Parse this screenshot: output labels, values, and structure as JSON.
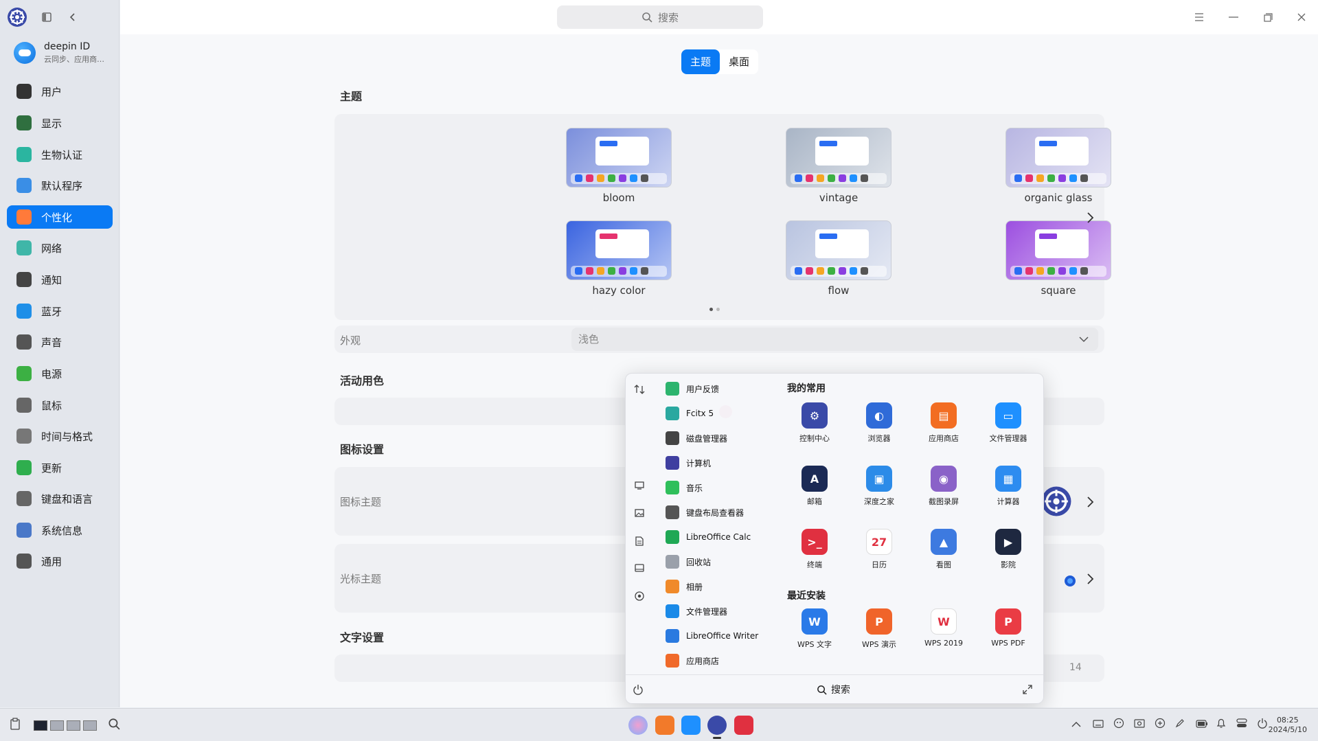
{
  "sidebar": {
    "deepin_id": {
      "name": "deepin ID",
      "subtitle": "云同步、应用商…"
    },
    "items": [
      {
        "label": "用户",
        "icon": "user-icon",
        "color": "#333333"
      },
      {
        "label": "显示",
        "icon": "display-icon",
        "color": "#2f6f3f"
      },
      {
        "label": "生物认证",
        "icon": "biometric-icon",
        "color": "#2bb5a0"
      },
      {
        "label": "默认程序",
        "icon": "default-apps-icon",
        "color": "#3a8ee6"
      },
      {
        "label": "个性化",
        "icon": "personalization-icon",
        "color": "#e35b2f"
      },
      {
        "label": "网络",
        "icon": "network-icon",
        "color": "#3fb6a8"
      },
      {
        "label": "通知",
        "icon": "notification-icon",
        "color": "#444444"
      },
      {
        "label": "蓝牙",
        "icon": "bluetooth-icon",
        "color": "#1f8fe8"
      },
      {
        "label": "声音",
        "icon": "sound-icon",
        "color": "#555555"
      },
      {
        "label": "电源",
        "icon": "power-icon",
        "color": "#3cb043"
      },
      {
        "label": "鼠标",
        "icon": "mouse-icon",
        "color": "#666666"
      },
      {
        "label": "时间与格式",
        "icon": "clock-icon",
        "color": "#777777"
      },
      {
        "label": "更新",
        "icon": "update-icon",
        "color": "#2fae4e"
      },
      {
        "label": "键盘和语言",
        "icon": "keyboard-icon",
        "color": "#666666"
      },
      {
        "label": "系统信息",
        "icon": "system-info-icon",
        "color": "#4a78c8"
      },
      {
        "label": "通用",
        "icon": "general-icon",
        "color": "#555555"
      }
    ],
    "active_index": 4
  },
  "search": {
    "placeholder": "搜索"
  },
  "tabs": [
    {
      "label": "主题",
      "active": true
    },
    {
      "label": "桌面",
      "active": false
    }
  ],
  "theme_section": {
    "title": "主题",
    "themes": [
      {
        "name": "bloom",
        "bg": "#7b8fdc",
        "bar": "#2a6df2"
      },
      {
        "name": "vintage",
        "bg": "#a9b5c6",
        "bar": "#2a6df2"
      },
      {
        "name": "organic glass",
        "bg": "#b8b6e2",
        "bar": "#2a6df2"
      },
      {
        "name": "hazy color",
        "bg": "#3a64e0",
        "bar": "#e5336e"
      },
      {
        "name": "flow",
        "bg": "#b9c4e0",
        "bar": "#2a6df2"
      },
      {
        "name": "square",
        "bg": "#9c4fe0",
        "bar": "#8a3ee0"
      }
    ],
    "appearance_label": "外观",
    "appearance_value": "浅色"
  },
  "accent_section": {
    "title": "活动用色",
    "color": "#e0336e"
  },
  "icon_section": {
    "title": "图标设置",
    "icon_theme_label": "图标主题",
    "cursor_theme_label": "光标主题"
  },
  "text_section": {
    "title": "文字设置",
    "size_value": "14"
  },
  "launcher": {
    "list": [
      {
        "label": "用户反馈",
        "color": "#2db46e"
      },
      {
        "label": "Fcitx 5",
        "color": "#2aa8a0"
      },
      {
        "label": "磁盘管理器",
        "color": "#444444"
      },
      {
        "label": "计算机",
        "color": "#3f3fa0"
      },
      {
        "label": "音乐",
        "color": "#2fbf5b"
      },
      {
        "label": "键盘布局查看器",
        "color": "#555555"
      },
      {
        "label": "LibreOffice Calc",
        "color": "#1fa855"
      },
      {
        "label": "回收站",
        "color": "#9aa0aa"
      },
      {
        "label": "相册",
        "color": "#f08a2a"
      },
      {
        "label": "文件管理器",
        "color": "#1a8ae8"
      },
      {
        "label": "LibreOffice Writer",
        "color": "#2a7ae0"
      },
      {
        "label": "应用商店",
        "color": "#f06a2a"
      }
    ],
    "favorites_title": "我的常用",
    "favorites": [
      {
        "label": "控制中心",
        "color": "#3a4aa8",
        "glyph": "⚙"
      },
      {
        "label": "浏览器",
        "color": "#2f6bd8",
        "glyph": "◐"
      },
      {
        "label": "应用商店",
        "color": "#f26d22",
        "glyph": "▤"
      },
      {
        "label": "文件管理器",
        "color": "#1e90ff",
        "glyph": "▭"
      },
      {
        "label": "邮箱",
        "color": "#1b2a55",
        "glyph": "A"
      },
      {
        "label": "深度之家",
        "color": "#2c8be8",
        "glyph": "▣"
      },
      {
        "label": "截图录屏",
        "color": "#8a62c8",
        "glyph": "◉"
      },
      {
        "label": "计算器",
        "color": "#2d8cf0",
        "glyph": "▦"
      },
      {
        "label": "终端",
        "color": "#e03040",
        "glyph": ">_"
      },
      {
        "label": "日历",
        "color": "#ffffff",
        "glyph": "27"
      },
      {
        "label": "看图",
        "color": "#3d7ae0",
        "glyph": "▲"
      },
      {
        "label": "影院",
        "color": "#1e2840",
        "glyph": "▶"
      }
    ],
    "recent_title": "最近安装",
    "recent": [
      {
        "label": "WPS 文字",
        "color": "#2a7ae8",
        "glyph": "W"
      },
      {
        "label": "WPS 演示",
        "color": "#f0642a",
        "glyph": "P"
      },
      {
        "label": "WPS 2019",
        "color": "#ffffff",
        "glyph": "W"
      },
      {
        "label": "WPS PDF",
        "color": "#ea3c44",
        "glyph": "P"
      }
    ],
    "search_label": "搜索"
  },
  "taskbar": {
    "time": "08:25",
    "date": "2024/5/10"
  }
}
